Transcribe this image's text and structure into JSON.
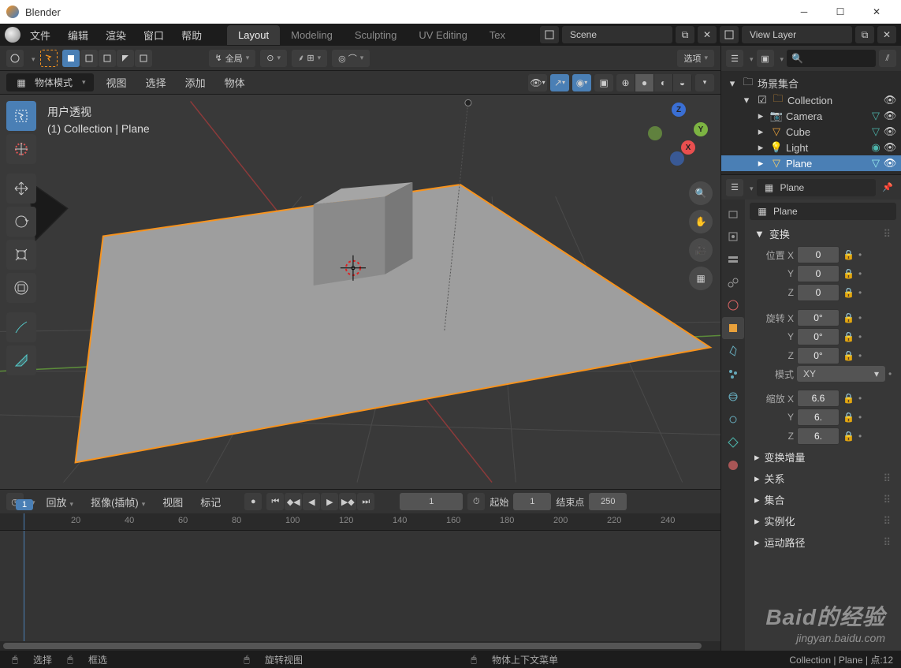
{
  "window": {
    "title": "Blender"
  },
  "menu": {
    "file": "文件",
    "edit": "编辑",
    "render": "渲染",
    "window": "窗口",
    "help": "帮助"
  },
  "tabs": {
    "layout": "Layout",
    "modeling": "Modeling",
    "sculpting": "Sculpting",
    "uv": "UV Editing",
    "tex": "Tex"
  },
  "scene": {
    "name": "Scene",
    "layer": "View Layer"
  },
  "toolbar": {
    "orientation": "全局",
    "options": "选项"
  },
  "viewheader": {
    "mode": "物体模式",
    "view": "视图",
    "select": "选择",
    "add": "添加",
    "object": "物体"
  },
  "viewport": {
    "persp": "用户透视",
    "context": "(1) Collection | Plane"
  },
  "gizmo": {
    "x": "X",
    "y": "Y",
    "z": "Z"
  },
  "timeline": {
    "playback": "回放",
    "keying": "抠像(插帧)",
    "view": "视图",
    "marker": "标记",
    "current": "1",
    "start_label": "起始",
    "start": "1",
    "end_label": "结束点",
    "end": "250",
    "ticks": [
      "20",
      "40",
      "60",
      "80",
      "100",
      "120",
      "140",
      "160",
      "180",
      "200",
      "220",
      "240"
    ],
    "frame_badge": "1"
  },
  "outliner": {
    "root": "场景集合",
    "collection": "Collection",
    "camera": "Camera",
    "cube": "Cube",
    "light": "Light",
    "plane": "Plane"
  },
  "props": {
    "breadcrumb": "Plane",
    "name": "Plane",
    "transform": "变换",
    "location": "位置",
    "rotation": "旋转",
    "mode_label": "模式",
    "mode_value": "XY",
    "scale": "缩放",
    "loc": {
      "x": "0",
      "y": "0",
      "z": "0"
    },
    "rot": {
      "x": "0°",
      "y": "0°",
      "z": "0°"
    },
    "scl": {
      "x": "6.6",
      "y": "6.",
      "z": "6."
    },
    "delta": "变换增量",
    "relations": "关系",
    "collections": "集合",
    "instancing": "实例化",
    "motion": "运动路径"
  },
  "status": {
    "select": "选择",
    "box": "框选",
    "rotate": "旋转视图",
    "context": "物体上下文菜单",
    "right": "Collection | Plane | 点:12"
  },
  "axes": {
    "x_label": "X",
    "y_label": "Y",
    "z_label": "Z"
  },
  "watermark": {
    "brand": "Baid的经验",
    "url": "jingyan.baidu.com"
  }
}
